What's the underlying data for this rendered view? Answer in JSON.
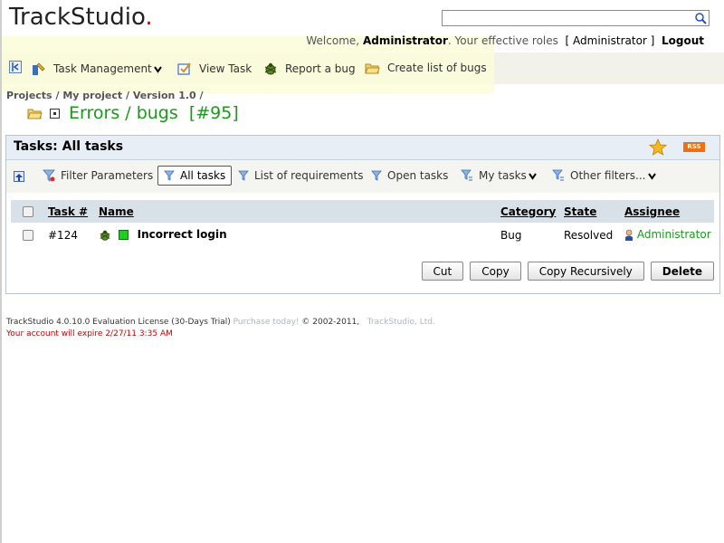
{
  "header": {
    "logo_text": "TrackStudio",
    "logo_dot": ".",
    "search": {
      "value": "",
      "placeholder": ""
    },
    "welcome_prefix": "Welcome,",
    "user_name": "Administrator",
    "roles_prefix": ". Your effective roles",
    "roles_value": "[ Administrator ]",
    "logout_label": "Logout"
  },
  "toolbar": {
    "items": [
      {
        "label": "Task Management"
      },
      {
        "label": "View Task"
      },
      {
        "label": "Report a bug"
      },
      {
        "label": "Create list of bugs"
      }
    ]
  },
  "breadcrumb": {
    "items": [
      "Projects",
      "My project",
      "Version 1.0"
    ],
    "separator": "/"
  },
  "page": {
    "title": "Errors / bugs  [#95]"
  },
  "panel": {
    "title": "Tasks: All tasks",
    "rss_label": "RSS",
    "filters": {
      "filter_parameters": "Filter Parameters",
      "all_tasks": "All tasks",
      "list_of_requirements": "List of requirements",
      "open_tasks": "Open tasks",
      "my_tasks": "My tasks",
      "other_filters": "Other filters..."
    },
    "table": {
      "columns": [
        "Task #",
        "Name",
        "Category",
        "State",
        "Assignee"
      ],
      "rows": [
        {
          "task_number": "#124",
          "name": "Incorrect login",
          "category": "Bug",
          "state": "Resolved",
          "assignee": "Administrator"
        }
      ]
    },
    "buttons": {
      "cut": "Cut",
      "copy": "Copy",
      "copy_recursively": "Copy Recursively",
      "delete": "Delete"
    }
  },
  "footer": {
    "license": "TrackStudio 4.0.10.0 Evaluation License (30-Days Trial)",
    "purchase": "Purchase today!",
    "copyright": "© 2002-2011,",
    "company": "TrackStudio, Ltd.",
    "expire": "Your account will expire 2/27/11 3:35 AM"
  },
  "colors": {
    "title_green": "#1a9a1a",
    "warning_red": "#cc0000",
    "rss_orange": "#f07010",
    "panel_header": "#e7eef5"
  }
}
